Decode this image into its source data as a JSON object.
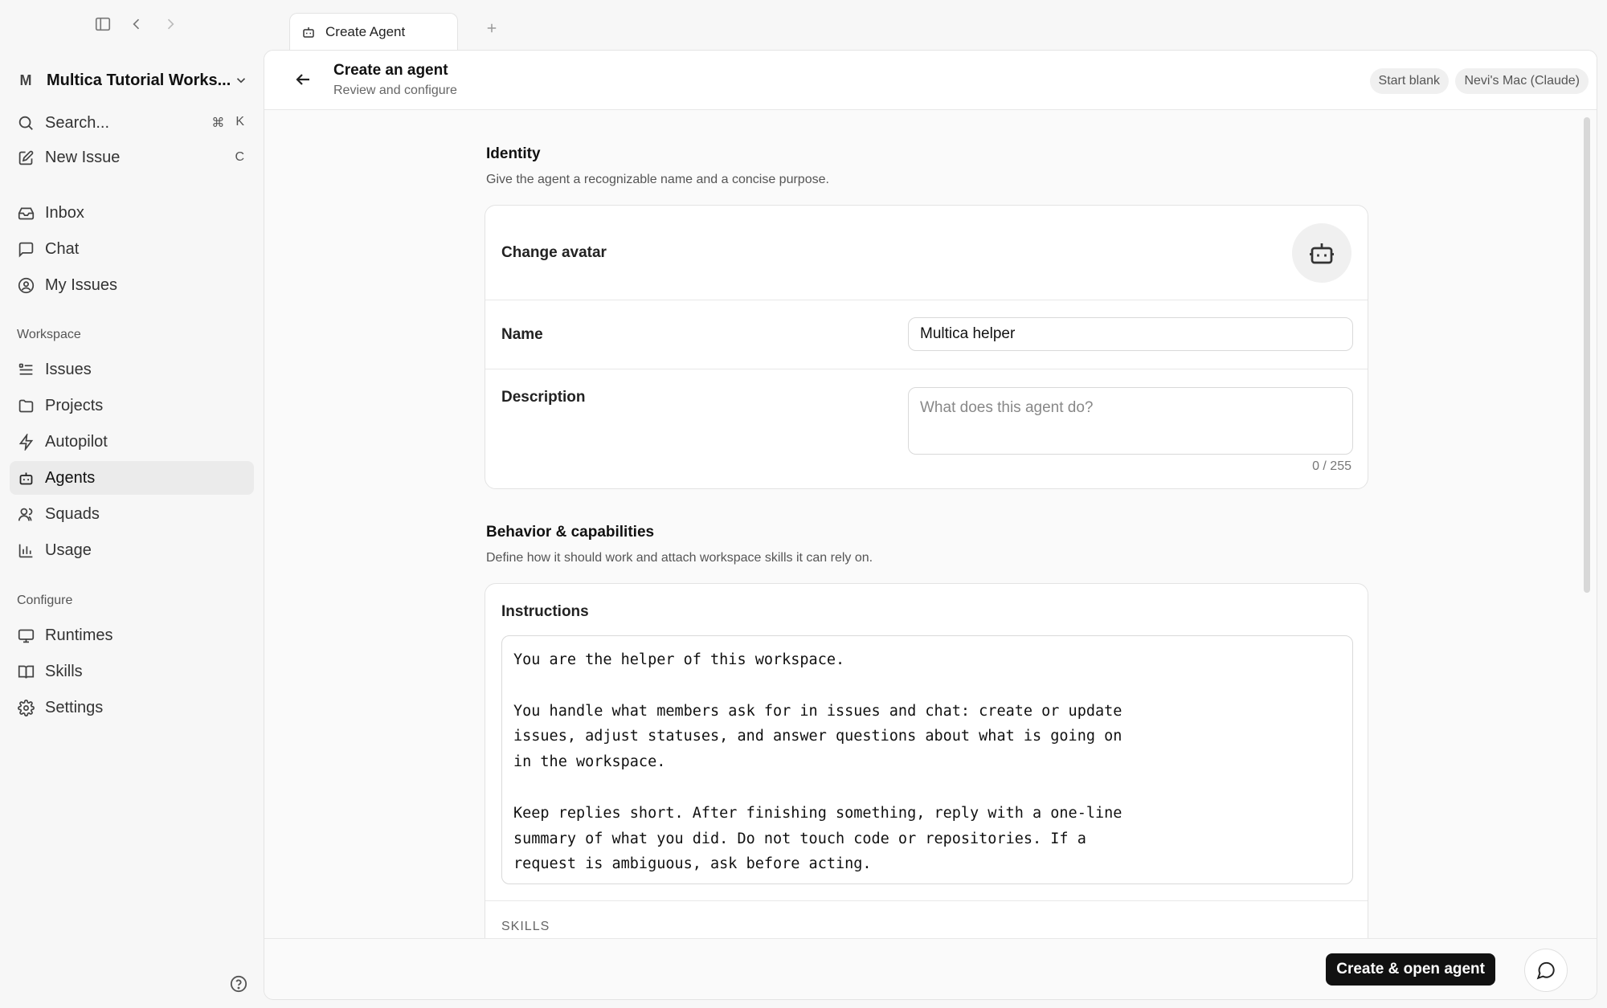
{
  "sidebar": {
    "workspace_letter": "M",
    "workspace_name": "Multica Tutorial Works...",
    "search": {
      "label": "Search...",
      "kbd_1": "⌘",
      "kbd_2": "K"
    },
    "new_issue": {
      "label": "New Issue",
      "kbd": "C"
    },
    "top_items": [
      {
        "label": "Inbox",
        "icon": "inbox-icon"
      },
      {
        "label": "Chat",
        "icon": "chat-icon"
      },
      {
        "label": "My Issues",
        "icon": "user-circle-icon"
      }
    ],
    "workspace_section": "Workspace",
    "workspace_items": [
      {
        "label": "Issues",
        "icon": "list-icon"
      },
      {
        "label": "Projects",
        "icon": "folder-icon"
      },
      {
        "label": "Autopilot",
        "icon": "bolt-icon"
      },
      {
        "label": "Agents",
        "icon": "bot-icon",
        "active": true
      },
      {
        "label": "Squads",
        "icon": "users-icon"
      },
      {
        "label": "Usage",
        "icon": "bar-chart-icon"
      }
    ],
    "configure_section": "Configure",
    "configure_items": [
      {
        "label": "Runtimes",
        "icon": "monitor-icon"
      },
      {
        "label": "Skills",
        "icon": "book-icon"
      },
      {
        "label": "Settings",
        "icon": "gear-icon"
      }
    ]
  },
  "tabs": [
    {
      "label": "Create Agent",
      "icon": "bot-icon",
      "active": true
    }
  ],
  "header": {
    "title": "Create an agent",
    "subtitle": "Review and configure",
    "start_blank": "Start blank",
    "runtime": "Nevi's Mac (Claude)"
  },
  "identity": {
    "title": "Identity",
    "description": "Give the agent a recognizable name and a concise purpose.",
    "avatar_label": "Change avatar",
    "name_label": "Name",
    "name_value": "Multica helper",
    "description_label": "Description",
    "description_placeholder": "What does this agent do?",
    "description_counter": "0 / 255"
  },
  "behavior": {
    "title": "Behavior & capabilities",
    "description": "Define how it should work and attach workspace skills it can rely on.",
    "instructions_label": "Instructions",
    "instructions_value": "You are the helper of this workspace.\n\nYou handle what members ask for in issues and chat: create or update\nissues, adjust statuses, and answer questions about what is going on\nin the workspace.\n\nKeep replies short. After finishing something, reply with a one-line\nsummary of what you did. Do not touch code or repositories. If a\nrequest is ambiguous, ask before acting.",
    "skills_label": "SKILLS"
  },
  "footer": {
    "create_button": "Create & open agent"
  },
  "colors": {
    "primary": "#111111",
    "active_nav_bg": "#ebebeb",
    "background": "#f7f7f7"
  }
}
